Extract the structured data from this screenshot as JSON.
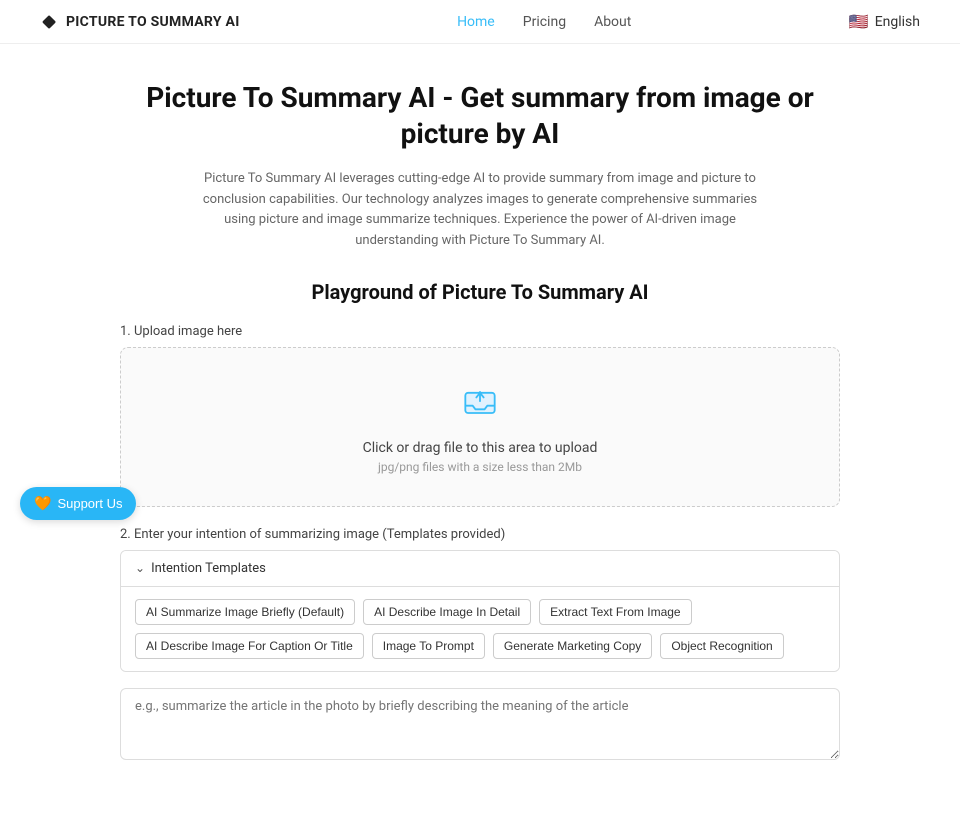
{
  "header": {
    "logo_text": "PICTURE TO SUMMARY AI",
    "nav": [
      {
        "label": "Home",
        "active": true
      },
      {
        "label": "Pricing",
        "active": false
      },
      {
        "label": "About",
        "active": false
      }
    ],
    "lang_flag": "🇺🇸",
    "lang_label": "English"
  },
  "hero": {
    "title": "Picture To Summary AI - Get summary from image or picture by AI",
    "description": "Picture To Summary AI leverages cutting-edge AI to provide summary from image and picture to conclusion capabilities. Our technology analyzes images to generate comprehensive summaries using picture and image summarize techniques. Experience the power of AI-driven image understanding with Picture To Summary AI."
  },
  "playground": {
    "title": "Playground of Picture To Summary AI",
    "upload_section_label": "1. Upload image here",
    "upload_main_text": "Click or drag file to this area to upload",
    "upload_sub_text": "jpg/png files with a size less than 2Mb",
    "intention_label": "2. Enter your intention of summarizing image (Templates provided)",
    "intention_panel_label": "Intention Templates",
    "template_tags": [
      "AI Summarize Image Briefly (Default)",
      "AI Describe Image In Detail",
      "Extract Text From Image",
      "AI Describe Image For Caption Or Title",
      "Image To Prompt",
      "Generate Marketing Copy",
      "Object Recognition"
    ],
    "textarea_placeholder": "e.g., summarize the article in the photo by briefly describing the meaning of the article"
  },
  "support": {
    "label": "Support Us"
  }
}
